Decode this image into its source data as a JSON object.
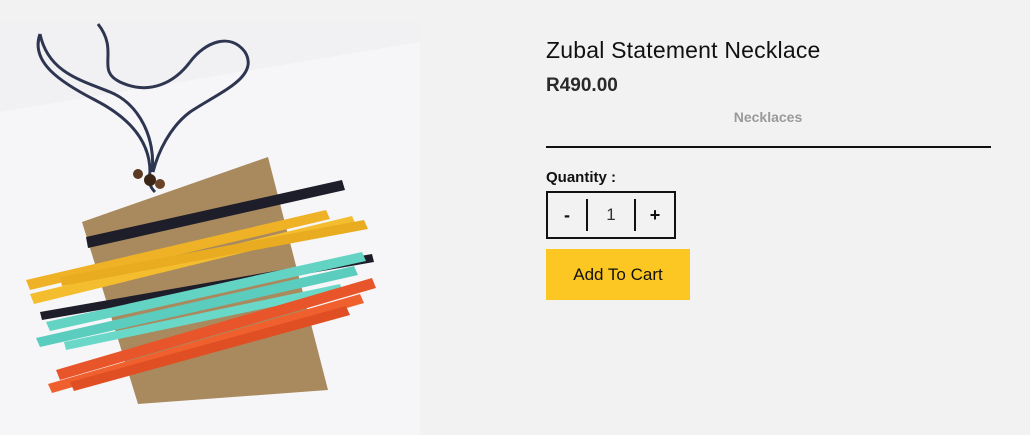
{
  "product": {
    "title": "Zubal Statement Necklace",
    "price": "R490.00",
    "category": "Necklaces",
    "image_icon": "necklace-photo"
  },
  "quantity": {
    "label": "Quantity :",
    "decrement_label": "-",
    "value": "1",
    "increment_label": "+"
  },
  "cart": {
    "add_label": "Add To Cart",
    "button_color": "#fcc723"
  }
}
